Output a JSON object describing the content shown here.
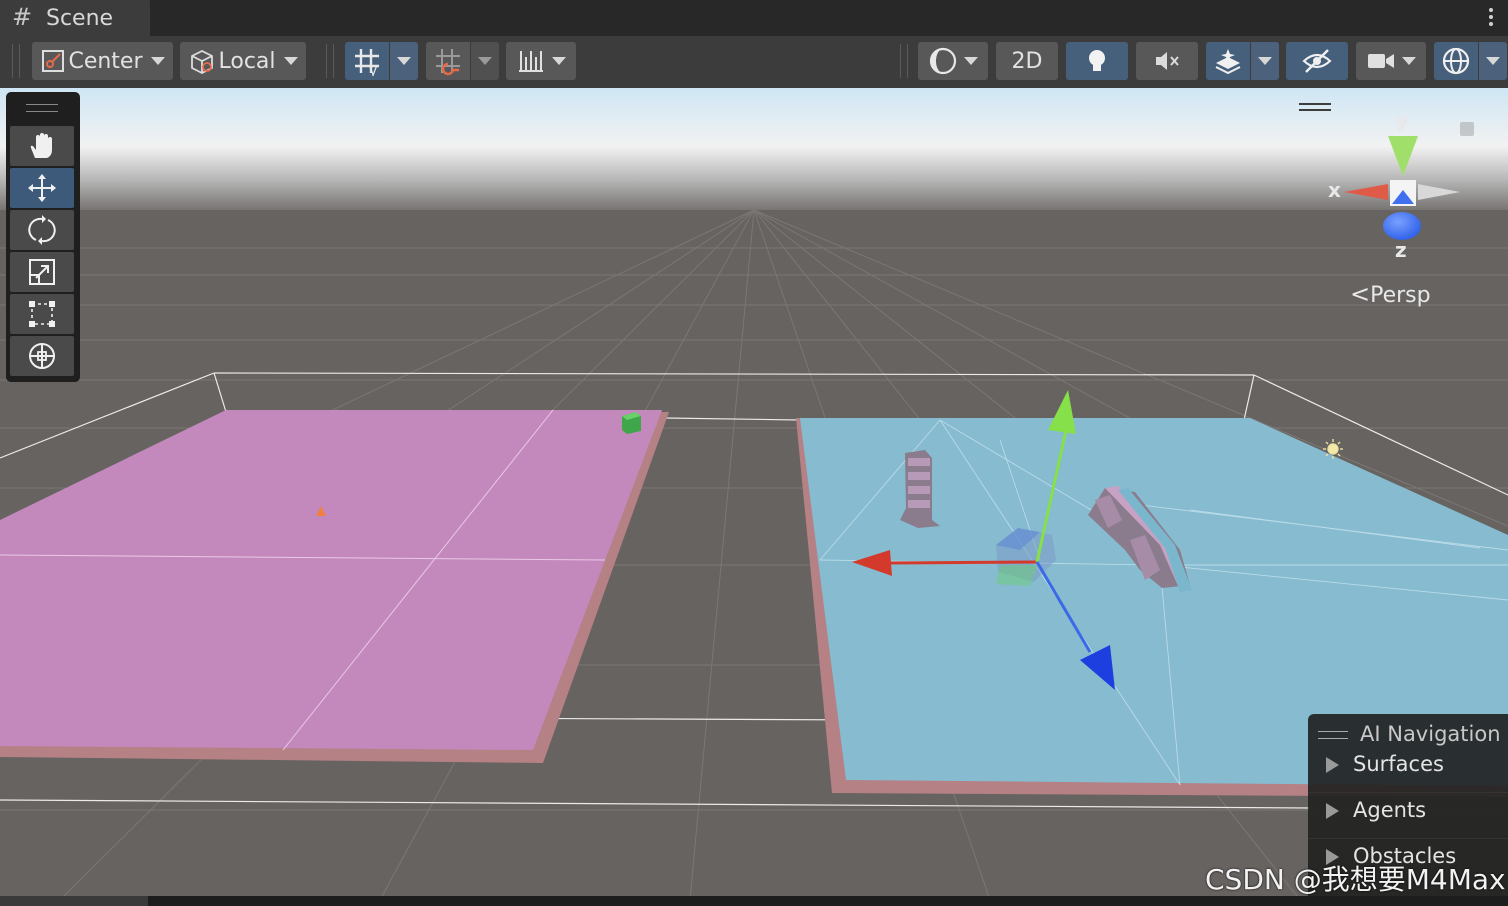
{
  "window": {
    "tab_title": "Scene"
  },
  "toolbar": {
    "pivot_mode": "Center",
    "pivot_rotation": "Local",
    "view_2d": "2D"
  },
  "tools": [
    "hand",
    "move",
    "rotate",
    "scale",
    "rect",
    "transform"
  ],
  "gizmo": {
    "x": "x",
    "y": "y",
    "z": "z",
    "projection": "Persp"
  },
  "ai_navigation": {
    "title": "AI Navigation",
    "items": [
      "Surfaces",
      "Agents",
      "Obstacles"
    ]
  },
  "watermark": "CSDN @我想要M4Max",
  "colors": {
    "ground_area": "#c389bd",
    "navmesh_area": "#86bbd0",
    "rim": "#b07f83",
    "active_button": "#46607c",
    "axis_x": "#d43a2c",
    "axis_y": "#86e04a",
    "axis_z": "#1e3fe0"
  }
}
